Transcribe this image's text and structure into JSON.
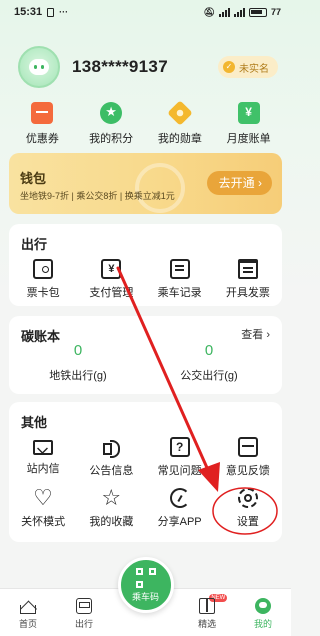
{
  "status_bar": {
    "time": "15:31",
    "battery": "77"
  },
  "profile": {
    "phone": "138****9137",
    "verify_label": "未实名"
  },
  "quick_links": [
    {
      "label": "优惠券",
      "icon": "coupon-icon",
      "color": "#f46a3c"
    },
    {
      "label": "我的积分",
      "icon": "points-icon",
      "color": "#3dbd66"
    },
    {
      "label": "我的勋章",
      "icon": "medal-icon",
      "color": "#f4b82e"
    },
    {
      "label": "月度账单",
      "icon": "bill-icon",
      "color": "#40c169"
    }
  ],
  "wallet": {
    "title": "钱包",
    "subtitle": "坐地铁9-7折 | 乘公交8折 | 换乘立减1元",
    "button": "去开通 ›"
  },
  "travel": {
    "title": "出行",
    "items": [
      {
        "label": "票卡包",
        "icon": "ticket-card-icon"
      },
      {
        "label": "支付管理",
        "icon": "payment-icon"
      },
      {
        "label": "乘车记录",
        "icon": "ride-record-icon"
      },
      {
        "label": "开具发票",
        "icon": "invoice-icon"
      }
    ]
  },
  "carbon": {
    "title": "碳账本",
    "more": "查看 ›",
    "metro_value": "0",
    "metro_label": "地铁出行(g)",
    "bus_value": "0",
    "bus_label": "公交出行(g)"
  },
  "other": {
    "title": "其他",
    "row1": [
      {
        "label": "站内信",
        "icon": "mail-icon"
      },
      {
        "label": "公告信息",
        "icon": "speaker-icon"
      },
      {
        "label": "常见问题",
        "icon": "faq-icon"
      },
      {
        "label": "意见反馈",
        "icon": "feedback-icon"
      }
    ],
    "row2": [
      {
        "label": "关怀模式",
        "icon": "care-icon"
      },
      {
        "label": "我的收藏",
        "icon": "star-icon"
      },
      {
        "label": "分享APP",
        "icon": "share-icon"
      },
      {
        "label": "设置",
        "icon": "gear-icon"
      }
    ]
  },
  "tabbar": {
    "home": "首页",
    "travel": "出行",
    "ride_code": "乘车码",
    "picks": "精选",
    "new_badge": "NEW",
    "mine": "我的"
  },
  "colors": {
    "accent": "#3db560",
    "wallet_button": "#e9a53a",
    "annotation": "#e02020"
  }
}
